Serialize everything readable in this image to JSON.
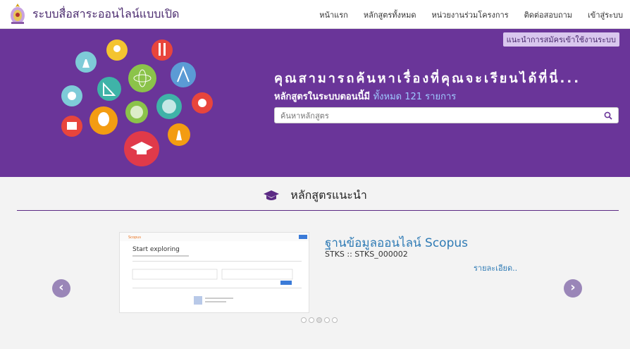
{
  "brand": {
    "title": "ระบบสื่อสาระออนไลน์แบบเปิด"
  },
  "nav": {
    "items": [
      "หน้าแรก",
      "หลักสูตรทั้งหมด",
      "หน่วยงานร่วมโครงการ",
      "ติดต่อสอบถาม",
      "เข้าสู่ระบบ"
    ]
  },
  "hero": {
    "signup_hint": "แนะนำการสมัครเข้าใช้งานระบบ",
    "title": "คุณสามารถค้นหาเรื่องที่คุณจะเรียนได้ที่นี่...",
    "subtitle_prefix": "หลักสูตรในระบบตอนนี้มี",
    "subtitle_count": "ทั้งหมด 121 รายการ",
    "search_placeholder": "ค้นหาหลักสูตร"
  },
  "featured": {
    "heading": "หลักสูตรแนะนำ",
    "slide": {
      "title": "ฐานข้อมูลออนไลน์ Scopus",
      "code": "STKS :: STKS_000002",
      "more": "รายละเอียด..",
      "image_heading": "Start exploring"
    },
    "prev": "‹",
    "next": "›",
    "dots_count": 5,
    "active_dot": 3
  },
  "colors": {
    "primary": "#6a3599",
    "link": "#2f7bb5",
    "nav_bg": "#ffffff"
  }
}
